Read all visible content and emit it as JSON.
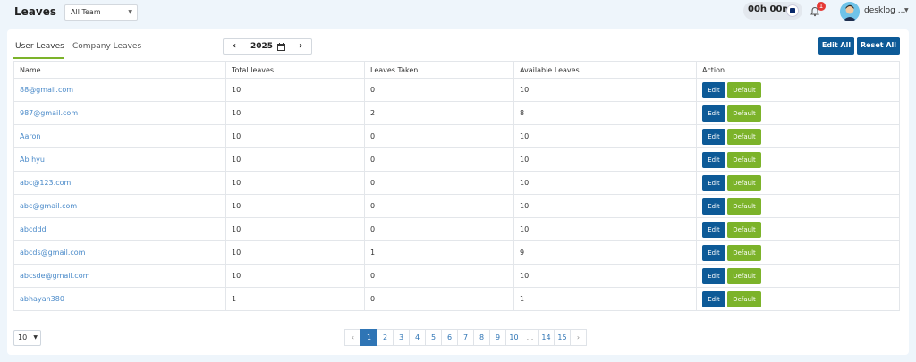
{
  "header": {
    "title": "Leaves",
    "team_filter": "All Team",
    "timer": "00h 00m",
    "notification_count": "1",
    "user_name": "desklog ..."
  },
  "tabs": [
    {
      "label": "User Leaves",
      "active": true
    },
    {
      "label": "Company Leaves",
      "active": false
    }
  ],
  "year": "2025",
  "actions": {
    "edit_all": "Edit All",
    "reset_all": "Reset All"
  },
  "table": {
    "columns": [
      "Name",
      "Total leaves",
      "Leaves Taken",
      "Available Leaves",
      "Action"
    ],
    "rows": [
      {
        "name": "88@gmail.com",
        "total": "10",
        "taken": "0",
        "available": "10"
      },
      {
        "name": "987@gmail.com",
        "total": "10",
        "taken": "2",
        "available": "8"
      },
      {
        "name": "Aaron",
        "total": "10",
        "taken": "0",
        "available": "10"
      },
      {
        "name": "Ab hyu",
        "total": "10",
        "taken": "0",
        "available": "10"
      },
      {
        "name": "abc@123.com",
        "total": "10",
        "taken": "0",
        "available": "10"
      },
      {
        "name": "abc@gmail.com",
        "total": "10",
        "taken": "0",
        "available": "10"
      },
      {
        "name": "abcddd",
        "total": "10",
        "taken": "0",
        "available": "10"
      },
      {
        "name": "abcds@gmail.com",
        "total": "10",
        "taken": "1",
        "available": "9"
      },
      {
        "name": "abcsde@gmail.com",
        "total": "10",
        "taken": "0",
        "available": "10"
      },
      {
        "name": "abhayan380",
        "total": "1",
        "taken": "0",
        "available": "1"
      }
    ],
    "row_actions": {
      "edit": "Edit",
      "default": "Default"
    }
  },
  "pagination": {
    "per_page": "10",
    "prev": "‹",
    "next": "›",
    "pages": [
      "1",
      "2",
      "3",
      "4",
      "5",
      "6",
      "7",
      "8",
      "9",
      "10",
      "...",
      "14",
      "15"
    ],
    "current": "1"
  },
  "colors": {
    "primary": "#0d5a97",
    "accent_green": "#7cb32a",
    "link": "#4a8ac9",
    "badge_red": "#e53935"
  }
}
